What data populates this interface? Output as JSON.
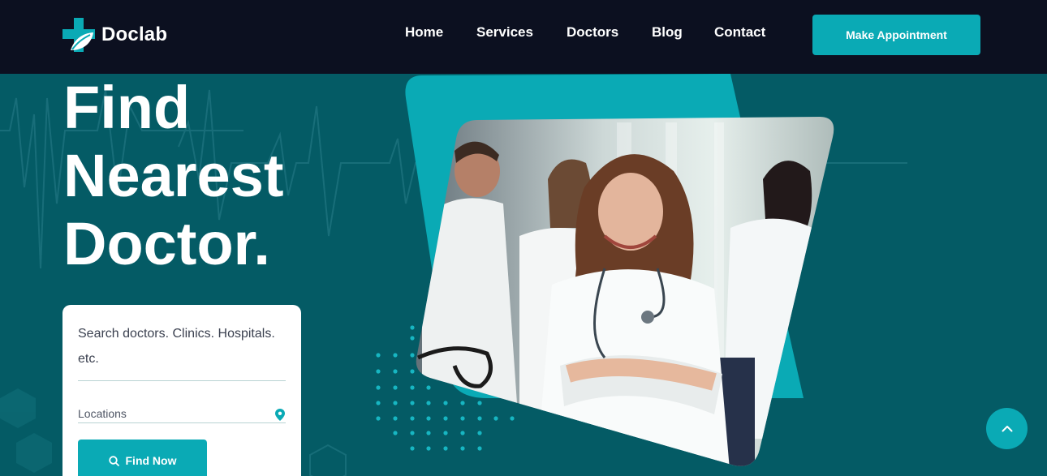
{
  "brand": {
    "name": "Doclab"
  },
  "nav": {
    "items": [
      {
        "label": "Home"
      },
      {
        "label": "Services"
      },
      {
        "label": "Doctors"
      },
      {
        "label": "Blog"
      },
      {
        "label": "Contact"
      }
    ],
    "cta_label": "Make Appointment"
  },
  "hero": {
    "title_lines": [
      "Find",
      "Nearest",
      "Doctor."
    ],
    "image_alt": "doctors-team-photo"
  },
  "search": {
    "placeholder": "Search doctors. Clinics. Hospitals. etc.",
    "location_placeholder": "Locations",
    "button_label": "Find Now"
  },
  "icons": {
    "logo": "medical-cross-leaf-icon",
    "location": "map-pin-icon",
    "search": "search-icon",
    "scroll_top": "chevron-up-icon"
  },
  "colors": {
    "nav_bg": "#0c1020",
    "hero_bg": "#045b65",
    "accent": "#0aaab5",
    "text_light": "#ffffff"
  }
}
